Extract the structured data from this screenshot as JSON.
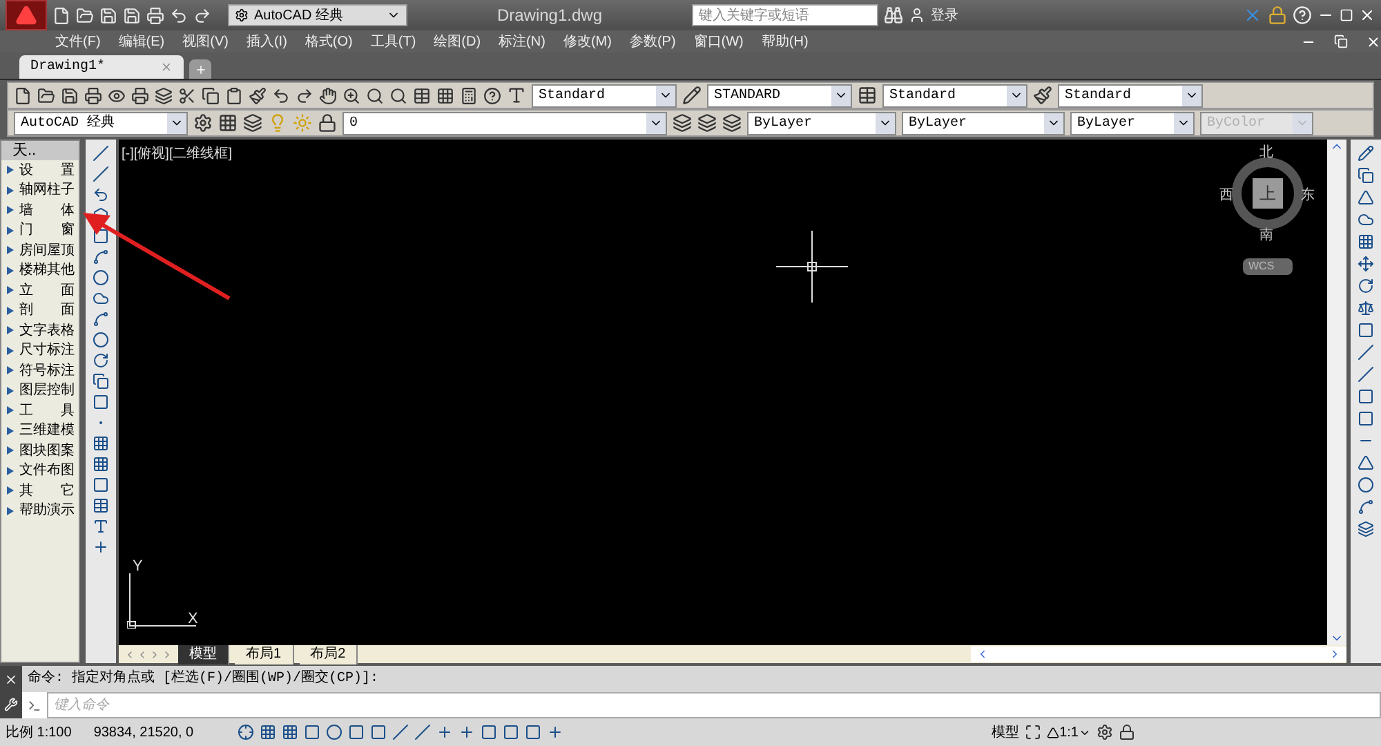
{
  "title_bar": {
    "workspace": "AutoCAD 经典",
    "title": "Drawing1.dwg",
    "search": {
      "placeholder": "键入关键字或短语"
    },
    "sign_in": "登录"
  },
  "menu": [
    "文件(F)",
    "编辑(E)",
    "视图(V)",
    "插入(I)",
    "格式(O)",
    "工具(T)",
    "绘图(D)",
    "标注(N)",
    "修改(M)",
    "参数(P)",
    "窗口(W)",
    "帮助(H)"
  ],
  "doc_tabs": [
    {
      "label": "Drawing1*",
      "selected": true
    }
  ],
  "style_toolbar": {
    "text_style": "Standard",
    "dim_style": "STANDARD",
    "table_style": "Standard",
    "mleader_style": "Standard"
  },
  "layer_toolbar": {
    "workspace": "AutoCAD 经典",
    "layer": "0",
    "color_control": "ByLayer",
    "linetype": "ByLayer",
    "lineweight": "ByLayer",
    "plot_style": {
      "value": "ByColor",
      "disabled": true
    }
  },
  "palette": {
    "title": "天..",
    "items": [
      "设　　置",
      "轴网柱子",
      "墙　　体",
      "门　　窗",
      "房间屋顶",
      "楼梯其他",
      "立　　面",
      "剖　　面",
      "文字表格",
      "尺寸标注",
      "符号标注",
      "图层控制",
      "工　　具",
      "三维建模",
      "图块图案",
      "文件布图",
      "其　　它",
      "帮助演示"
    ]
  },
  "viewport": {
    "label": "[-][俯视][二维线框]",
    "viewcube": {
      "north": "北",
      "south": "南",
      "east": "东",
      "west": "西",
      "face": "上",
      "ucs": "WCS"
    },
    "ucs_icon": {
      "y": "Y",
      "x": "X"
    }
  },
  "layout_tabs": [
    {
      "label": "模型",
      "selected": true
    },
    {
      "label": "布局1",
      "selected": false
    },
    {
      "label": "布局2",
      "selected": false
    }
  ],
  "command": {
    "history": "命令: 指定对角点或 [栏选(F)/圈围(WP)/圈交(CP)]:",
    "placeholder": "键入命令"
  },
  "status_bar": {
    "scale": "比例 1:100",
    "coordinates": "93834, 21520, 0",
    "model": "模型",
    "annotation_scale": "1:1"
  }
}
